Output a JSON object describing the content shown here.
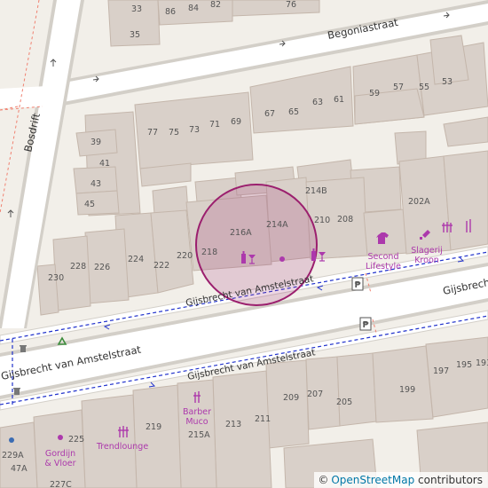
{
  "map": {
    "streets": {
      "begoniastraat": "Begoniastraat",
      "bosdrift": "Bosdrift",
      "gijsbrecht_main": "Gijsbrecht van Amstelstraat",
      "gijsbrecht_upper": "Gijsbrecht van Amstelstraat",
      "gijsbrecht_lower": "Gijsbrecht van Amstelstraat",
      "gijsbrecht_right": "Gijsbrecht"
    },
    "house_numbers": {
      "n33": "33",
      "n35": "35",
      "n86": "86",
      "n84": "84",
      "n82": "82",
      "n76": "76",
      "n39": "39",
      "n41": "41",
      "n43": "43",
      "n45": "45",
      "n77": "77",
      "n75": "75",
      "n73": "73",
      "n71": "71",
      "n69": "69",
      "n67": "67",
      "n65": "65",
      "n63": "63",
      "n61": "61",
      "n59": "59",
      "n57": "57",
      "n55": "55",
      "n53": "53",
      "n214b": "214B",
      "n214a": "214A",
      "n216a": "216A",
      "n210": "210",
      "n208": "208",
      "n202a": "202A",
      "n228": "228",
      "n226": "226",
      "n224": "224",
      "n222": "222",
      "n220": "220",
      "n218": "218",
      "n230": "230",
      "n209": "209",
      "n207": "207",
      "n205": "205",
      "n199": "199",
      "n197": "197",
      "n195": "195",
      "n193": "193",
      "n213": "213",
      "n211": "211",
      "n219": "219",
      "n215a": "215A",
      "n225": "225",
      "n229a": "229A",
      "n47a": "47A",
      "n227c": "227C"
    },
    "pois": {
      "second_lifestyle": "Second\nLifestyle",
      "slagerij_kroon": "Slagerij\nKroon",
      "barber_muco": "Barber\nMuco",
      "trendlounge": "Trendlounge",
      "gordijn_vloer": "Gordijn\n& Vloer"
    },
    "icons": [
      "clothes-shop-icon",
      "butcher-icon",
      "hairdresser-icon",
      "beauty-icon",
      "wine-bar-icon",
      "bicycle-parking-icon",
      "recycling-icon",
      "waste-basket-icon",
      "marker-dot-icon"
    ],
    "colors": {
      "background": "#f2efe9",
      "building": "#d9d0c9",
      "building_stroke": "#c4b6ab",
      "road": "#ffffff",
      "road_casing": "#d3cfc8",
      "bus_route": "#2233cc",
      "poi": "#ac39ac",
      "highlight": "#9b1f6e",
      "label": "#333333"
    }
  },
  "attribution": {
    "symbol": "©",
    "link": "OpenStreetMap",
    "suffix": " contributors"
  }
}
